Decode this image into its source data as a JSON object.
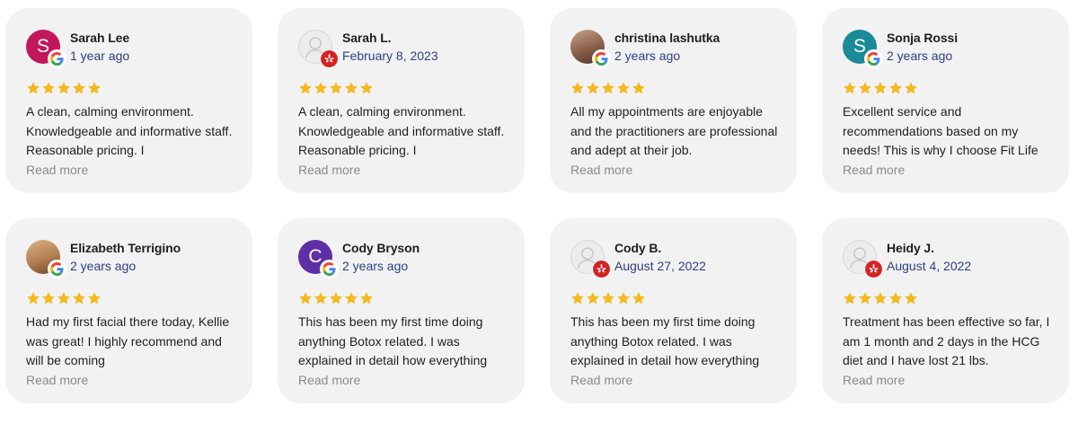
{
  "reviews": [
    {
      "name": "Sarah Lee",
      "date": "1 year ago",
      "avatar_letter": "S",
      "avatar_color": "#c2185b",
      "avatar_type": "letter",
      "source": "google-icon",
      "rating": 5,
      "text": "A clean, calming environment. Knowledgeable and informative staff. Reasonable pricing. I",
      "more": "Read more"
    },
    {
      "name": "Sarah L.",
      "date": "February 8, 2023",
      "avatar_letter": "",
      "avatar_color": "#ececec",
      "avatar_type": "anon",
      "source": "yelp-icon",
      "rating": 5,
      "text": "A clean, calming environment. Knowledgeable and informative staff. Reasonable pricing. I",
      "more": "Read more"
    },
    {
      "name": "christina lashutka",
      "date": "2 years ago",
      "avatar_letter": "",
      "avatar_color": "#c8a38a",
      "avatar_type": "photo",
      "source": "google-icon",
      "rating": 5,
      "text": "All my appointments are enjoyable and the practitioners are professional and adept at their job.",
      "more": "Read more"
    },
    {
      "name": "Sonja Rossi",
      "date": "2 years ago",
      "avatar_letter": "S",
      "avatar_color": "#1a8a96",
      "avatar_type": "letter",
      "source": "google-icon",
      "rating": 5,
      "text": "Excellent service and recommendations based on my needs! This is why I choose Fit Life",
      "more": "Read more"
    },
    {
      "name": "Elizabeth Terrigino",
      "date": "2 years ago",
      "avatar_letter": "",
      "avatar_color": "#d9b487",
      "avatar_type": "photo2",
      "source": "google-icon",
      "rating": 5,
      "text": "Had my first facial there today, Kellie was great! I highly recommend and will be coming",
      "more": "Read more"
    },
    {
      "name": "Cody Bryson",
      "date": "2 years ago",
      "avatar_letter": "C",
      "avatar_color": "#5e2fa6",
      "avatar_type": "letter",
      "source": "google-icon",
      "rating": 5,
      "text": "This has been my first time doing anything Botox related. I was explained in detail how everything",
      "more": "Read more"
    },
    {
      "name": "Cody B.",
      "date": "August 27, 2022",
      "avatar_letter": "",
      "avatar_color": "#ececec",
      "avatar_type": "anon",
      "source": "yelp-icon",
      "rating": 5,
      "text": "This has been my first time doing anything Botox related. I was explained in detail how everything",
      "more": "Read more"
    },
    {
      "name": "Heidy J.",
      "date": "August 4, 2022",
      "avatar_letter": "",
      "avatar_color": "#ececec",
      "avatar_type": "anon",
      "source": "yelp-icon",
      "rating": 5,
      "text": "Treatment has been effective so far, I am 1 month and 2 days in the HCG diet and I have lost 21 lbs.",
      "more": "Read more"
    }
  ],
  "colors": {
    "star": "#f5b820",
    "date_link": "#2c3e86",
    "read_more": "#8a8a8a",
    "card_bg": "#f2f2f2"
  }
}
